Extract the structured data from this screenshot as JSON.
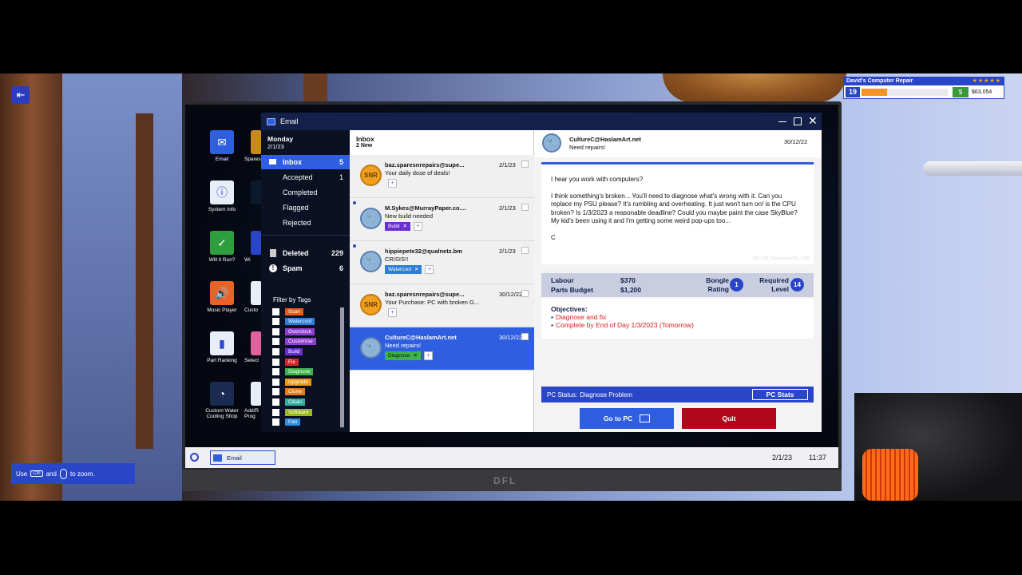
{
  "hud": {
    "shop_name": "David's Computer Repair",
    "level": "19",
    "xp_fraction": 0.3,
    "money": "$63,054",
    "stars": 5
  },
  "zoom_hint": {
    "use": "Use",
    "key": "Ctrl",
    "and": "and",
    "to_zoom": "to zoom."
  },
  "monitor_brand": "DFL",
  "desktop_icons": [
    {
      "label": "Email",
      "icon": "envelope-icon",
      "color": "#2f5fe0"
    },
    {
      "label": "System Info",
      "icon": "info-icon",
      "color": "#e8eef8"
    },
    {
      "label": "Will it Run?",
      "icon": "check-icon",
      "color": "#2e9d3e"
    },
    {
      "label": "Music Player",
      "icon": "speaker-icon",
      "color": "#e8622a"
    },
    {
      "label": "Part Ranking",
      "icon": "bar-chart-icon",
      "color": "#e8eef8"
    },
    {
      "label": "Custom Water Cooling Shop",
      "icon": "cooling-icon",
      "color": "#1a2a50"
    }
  ],
  "desktop_icons_partial": [
    {
      "label": "Spares",
      "icon": "spares-icon"
    },
    {
      "label": "",
      "icon": "wave-icon"
    },
    {
      "label": "Wi",
      "icon": "window-icon"
    },
    {
      "label": "Custo",
      "icon": "target-icon"
    },
    {
      "label": "Select",
      "icon": "select-icon"
    },
    {
      "label": "Add/R Prog",
      "icon": "programs-icon"
    }
  ],
  "window": {
    "title": "Email"
  },
  "sidebar": {
    "day": "Monday",
    "date": "2/1/23",
    "inbox": {
      "label": "Inbox",
      "count": "5"
    },
    "accepted": {
      "label": "Accepted",
      "count": "1"
    },
    "completed": {
      "label": "Completed"
    },
    "flagged": {
      "label": "Flagged"
    },
    "rejected": {
      "label": "Rejected"
    },
    "deleted": {
      "label": "Deleted",
      "count": "229"
    },
    "spam": {
      "label": "Spam",
      "count": "6"
    },
    "filter_title": "Filter by Tags",
    "tags": [
      {
        "label": "Scan",
        "color": "#e55a1c"
      },
      {
        "label": "Watercool",
        "color": "#2f7fd8"
      },
      {
        "label": "Overclock",
        "color": "#8e3fcf"
      },
      {
        "label": "Customise",
        "color": "#8e3fcf"
      },
      {
        "label": "Build",
        "color": "#6a2fd0"
      },
      {
        "label": "Fix",
        "color": "#d12a2a"
      },
      {
        "label": "Diagnose",
        "color": "#3cb44a"
      },
      {
        "label": "Upgrade",
        "color": "#e89a18"
      },
      {
        "label": "Clone",
        "color": "#e87a18"
      },
      {
        "label": "Clean",
        "color": "#2cb0a0"
      },
      {
        "label": "Software",
        "color": "#9ab820"
      },
      {
        "label": "Fan",
        "color": "#2f8fe0"
      }
    ]
  },
  "list": {
    "title": "Inbox",
    "new_count": "2 New",
    "emails": [
      {
        "from": "baz.sparesnrepairs@supe...",
        "subject": "Your daily dose of deals!",
        "date": "2/1/23",
        "avatar": "SNR",
        "unread": false,
        "tag": null
      },
      {
        "from": "M.Sykes@MurrayPaper.co....",
        "subject": "New build needed",
        "date": "2/1/23",
        "avatar": "wrench",
        "unread": true,
        "tag": {
          "label": "Build",
          "color": "#6a2fd0"
        }
      },
      {
        "from": "hippiepete32@qualnetz.bm",
        "subject": "CRISIS!!",
        "date": "2/1/23",
        "avatar": "wrench",
        "unread": true,
        "tag": {
          "label": "Watercool",
          "color": "#2f7fd8"
        }
      },
      {
        "from": "baz.sparesnrepairs@supe...",
        "subject": "Your Purchase: PC with broken G...",
        "date": "30/12/22",
        "avatar": "SNR",
        "unread": false,
        "tag": null
      },
      {
        "from": "CultureC@HaslamArt.net",
        "subject": "Need repairs!",
        "date": "30/12/22",
        "avatar": "wrench",
        "unread": false,
        "selected": true,
        "tag": {
          "label": "Diagnose",
          "color": "#3cb44a"
        }
      }
    ]
  },
  "detail": {
    "from": "CultureC@HaslamArt.net",
    "subject": "Need repairs!",
    "date": "30/12/22",
    "body_1": "I hear you work with computers?",
    "body_2": "I think something's broken... You'll need to diagnose what's wrong with it. Can you replace my PSU please? It's rumbling and overheating. It just won't turn on! is the CPU broken? Is 1/3/2023 a reasonable deadline? Could you maybe paint the case SkyBlue? My kid's been using it and I'm getting some weird pop-ups too...",
    "signature": "C",
    "job_id": "DS_006_Diagnose&Fix_1000",
    "labour_label": "Labour",
    "labour_value": "$370",
    "parts_label": "Parts Budget",
    "parts_value": "$1,200",
    "bongle_label": "Bongle Rating",
    "bongle_value": "1",
    "required_label": "Required Level",
    "required_value": "14",
    "objectives_title": "Objectives:",
    "objective_1": "Diagnose and fix",
    "objective_2": "Complete by End of Day 1/3/2023 (Tomorrow)",
    "status_label": "PC Status:",
    "status_value": "Diagnose Problem",
    "pc_stats": "PC Stats",
    "goto_pc": "Go to PC",
    "quit": "Quit"
  },
  "taskbar": {
    "app": "Email",
    "date": "2/1/23",
    "time": "11:37"
  },
  "colors": {
    "accent": "#2f5fe0",
    "titlebar": "#13204a",
    "sidebar": "#0c1023",
    "quit": "#b0081a",
    "objective": "#d81c1c"
  }
}
